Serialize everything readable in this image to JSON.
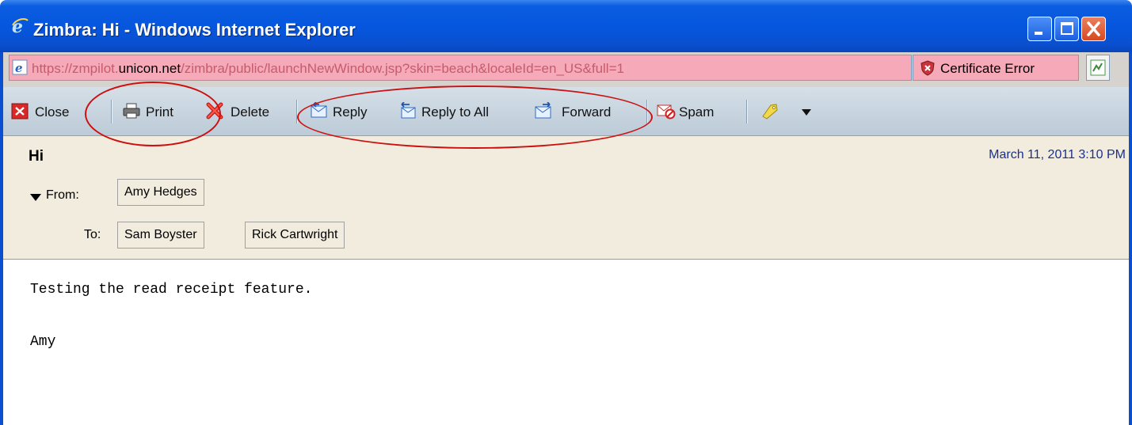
{
  "window": {
    "title": "Zimbra: Hi - Windows Internet Explorer",
    "buttons": [
      "minimize-icon",
      "maximize-icon",
      "close-icon"
    ]
  },
  "address_bar": {
    "url_prefix": "https://zmpilot.",
    "url_domain": "unicon.net",
    "url_suffix": "/zimbra/public/launchNewWindow.jsp?skin=beach&localeId=en_US&full=1",
    "certificate_error": "Certificate Error"
  },
  "toolbar": {
    "close": "Close",
    "print": "Print",
    "delete": "Delete",
    "reply": "Reply",
    "reply_all": "Reply to All",
    "forward": "Forward",
    "spam": "Spam"
  },
  "message": {
    "subject": "Hi",
    "date": "March 11, 2011 3:10 PM",
    "from_label": "From:",
    "from": "Amy Hedges",
    "to_label": "To:",
    "to": [
      "Sam Boyster",
      "Rick Cartwright"
    ],
    "body_lines": [
      "Testing the read receipt feature.",
      "Amy"
    ]
  },
  "colors": {
    "titlebar": "#0556dd",
    "address_error_bg": "#f6a9b8",
    "toolbar_bg": "#c8d5e0",
    "header_bg": "#f1ecdd",
    "date_color": "#1a2f8f",
    "annotation_red": "#cc1010"
  }
}
